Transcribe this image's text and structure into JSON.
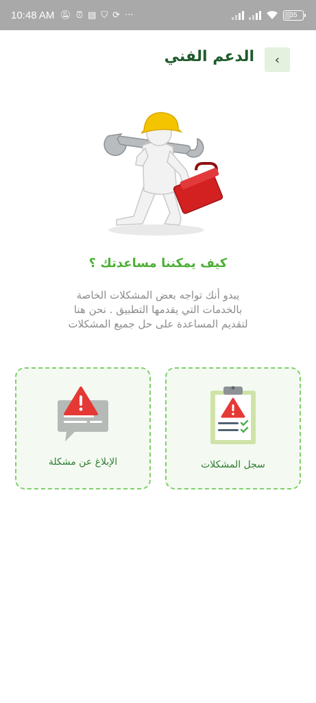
{
  "status_bar": {
    "time": "10:48 AM",
    "icons": [
      "mute-icon",
      "alarm-icon",
      "notification-icon",
      "shield-icon",
      "sync-icon",
      "more-icon"
    ],
    "battery": "35",
    "battery_level": 0.35,
    "right_icons": [
      "signal-icon",
      "signal-icon",
      "wifi-icon",
      "battery-icon"
    ]
  },
  "header": {
    "title": "الدعم الفني",
    "back_icon": "chevron-left-icon"
  },
  "colors": {
    "accent_green": "#4caf36",
    "title_green": "#1f5b2b",
    "card_border": "#7fcf6a",
    "alert_red": "#e53935"
  },
  "main": {
    "question": "كيف يمكننا مساعدتك ؟",
    "description_lines": [
      "يبدو أنك تواجه بعض المشكلات الخاصة",
      "بالخدمات التي  يقدمها التطبيق . نحن هنا",
      "لتقديم المساعدة على حل جميع المشكلات"
    ]
  },
  "cards": {
    "report": {
      "label": "الإبلاغ عن مشكلة",
      "icon": "alert-message-icon"
    },
    "log": {
      "label": "سجل المشكلات",
      "icon": "clipboard-alert-icon"
    }
  }
}
